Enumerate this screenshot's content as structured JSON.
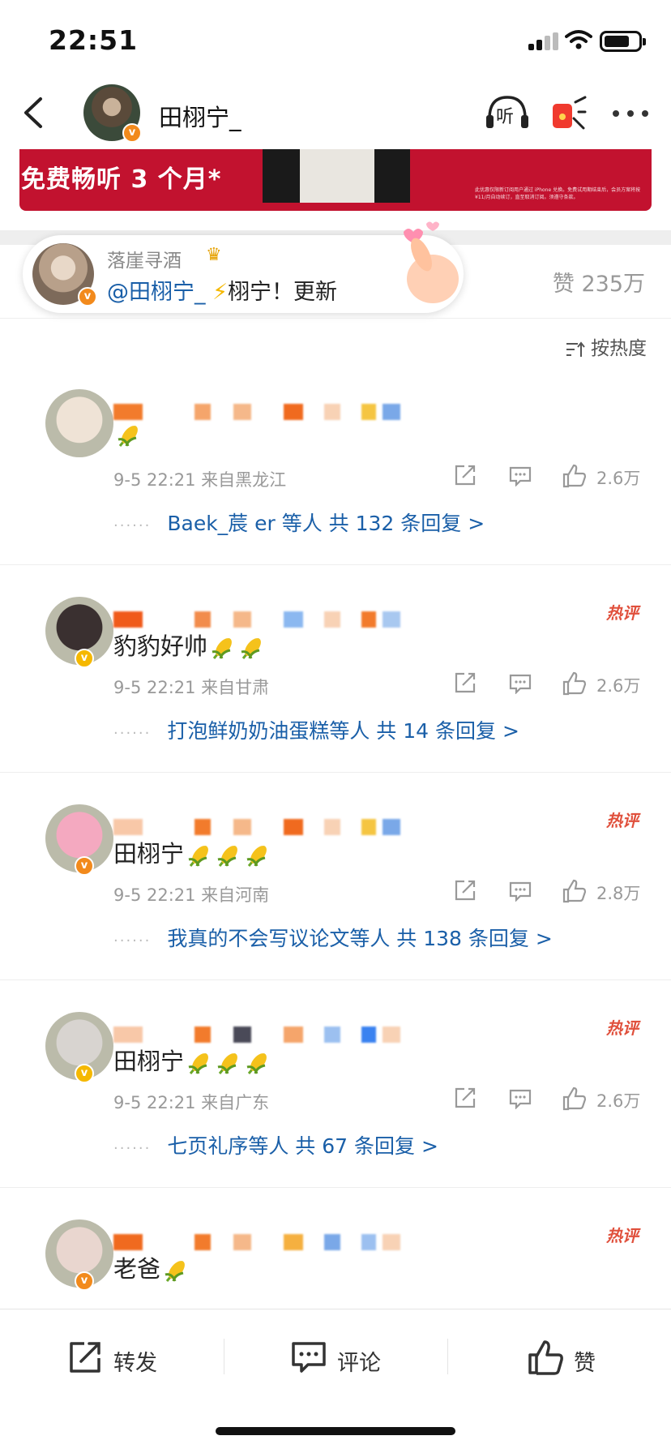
{
  "status_bar": {
    "time": "22:51"
  },
  "nav": {
    "title": "田栩宁_",
    "listen_label": "听"
  },
  "banner": {
    "text": "免费畅听 3 个月*",
    "fine_print": "此优惠仅限新订阅用户通过 iPhone 兑换。免费试用期结束后，会员方案将按 ¥11/月自动续订，直至取消订阅。须遵守条款。"
  },
  "pinned": {
    "user": "落崖寻酒",
    "mention": "@田栩宁_",
    "text": "栩宁！更新",
    "likes": "赞 235万"
  },
  "sort_label": "按热度",
  "comments": [
    {
      "text": "",
      "meta": "9-5 22:21 来自黑龙江",
      "likes": "2.6万",
      "replies": "Baek_莀 er 等人  共 132 条回复 >",
      "hot": "",
      "corns": 1,
      "avatar_color": "#efe3d6"
    },
    {
      "text": "豹豹好帅",
      "meta": "9-5 22:21 来自甘肃",
      "likes": "2.6万",
      "replies": "打泡鲜奶奶油蛋糕等人  共 14 条回复 >",
      "hot": "热评",
      "corns": 2,
      "avatar_color": "#3a3030"
    },
    {
      "text": "田栩宁",
      "meta": "9-5 22:21 来自河南",
      "likes": "2.8万",
      "replies": "我真的不会写议论文等人  共 138 条回复 >",
      "hot": "热评",
      "corns": 3,
      "avatar_color": "#f4a9c0"
    },
    {
      "text": "田栩宁",
      "meta": "9-5 22:21 来自广东",
      "likes": "2.6万",
      "replies": "七页礼序等人  共 67 条回复 >",
      "hot": "热评",
      "corns": 3,
      "avatar_color": "#d8d4d0"
    },
    {
      "text": "老爸",
      "meta": "",
      "likes": "",
      "replies": "",
      "hot": "热评",
      "corns": 1,
      "avatar_color": "#e9d6cf"
    }
  ],
  "bottom_bar": {
    "repost": "转发",
    "comment": "评论",
    "like": "赞"
  },
  "colors": {
    "accent_blue": "#1a5fa8",
    "hot_red": "#e0503c",
    "banner_red": "#c2122f",
    "verified_orange": "#f28a1c",
    "verified_gold": "#f5b800"
  }
}
